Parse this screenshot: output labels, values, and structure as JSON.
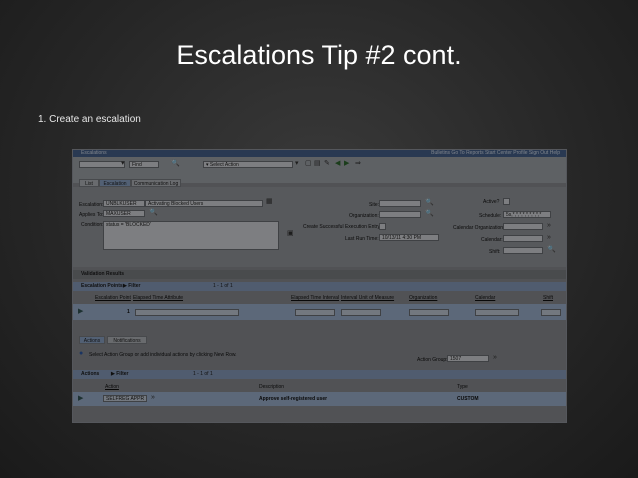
{
  "slide": {
    "title": "Escalations Tip #2 cont.",
    "bullet": "1. Create an escalation"
  },
  "app": {
    "name": "Escalations",
    "header_links": "Bulletins  Go To  Reports  Start Center  Profile  Sign Out  Help"
  },
  "toolbar": {
    "find_label": "Find",
    "select_action": "Select Action"
  },
  "tabs": [
    "List",
    "Escalation",
    "Communication Log"
  ],
  "form": {
    "escalation_label": "Escalation:",
    "escalation_value": "UNBLKUSER",
    "description_value": "Activating Blocked Users",
    "applies_to_label": "Applies To:",
    "applies_to_value": "MAXUSER",
    "condition_label": "Condition:",
    "condition_value": "status = 'BLOCKED'",
    "site_label": "Site:",
    "organization_label": "Organization:",
    "create_entry_label": "Create Successful Execution Entry?",
    "last_run_label": "Last Run Time:",
    "last_run_value": "10/13/11 4:30 PM",
    "active_label": "Active?",
    "schedule_label": "Schedule:",
    "schedule_value": "5s,*,*,*,*,*,*,*,*,*",
    "calendar_org_label": "Calendar Organization:",
    "calendar_label": "Calendar:",
    "shift_label": "Shift:"
  },
  "validation_results": "Validation Results",
  "escalation_points": {
    "title": "Escalation Points",
    "filter": "Filter",
    "pager": "1 - 1 of 1",
    "columns": [
      "Escalation Point",
      "Elapsed Time Attribute",
      "Elapsed Time Interval",
      "Interval Unit of Measure",
      "Organization",
      "Calendar",
      "Shift"
    ],
    "row_value": "1"
  },
  "lower_tabs": [
    "Actions",
    "Notifications"
  ],
  "info_text": "Select Action Group or add individual actions by clicking New Row.",
  "action_group_label": "Action Group:",
  "action_group_value": "1507",
  "actions_table": {
    "title": "Actions",
    "filter": "Filter",
    "pager": "1 - 1 of 1",
    "columns": [
      "Action",
      "Description",
      "Type"
    ],
    "rows": [
      {
        "action": "SELFREG APPR",
        "description": "Approve self-registered user",
        "type": "CUSTOM"
      }
    ]
  }
}
